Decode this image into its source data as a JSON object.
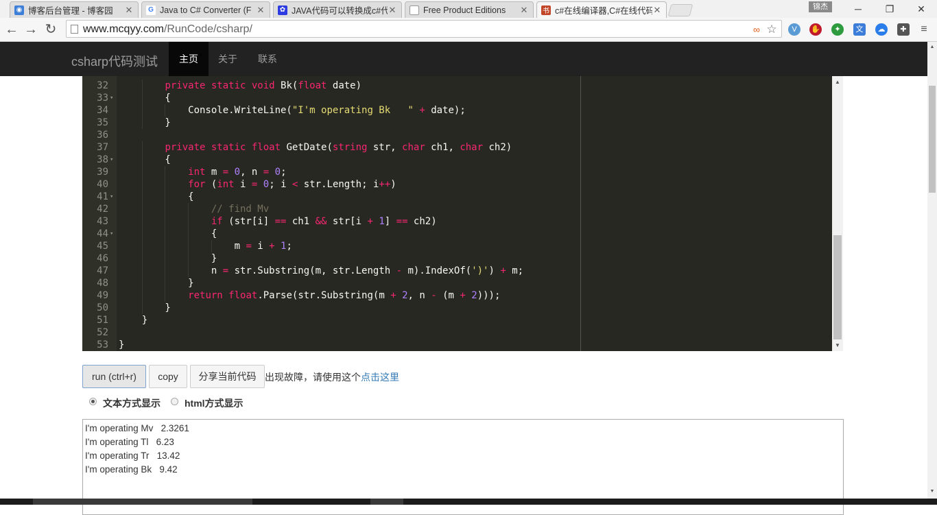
{
  "browser": {
    "tabs": [
      {
        "title": "博客后台管理 - 博客园",
        "icon_color": "#3d7fd8",
        "icon": "cnblogs-icon",
        "active": false
      },
      {
        "title": "Java to C# Converter (F",
        "icon_color": "#ffffff",
        "icon": "google-icon",
        "active": false
      },
      {
        "title": "JAVA代码可以转换成c#代",
        "icon_color": "#2d3ce0",
        "icon": "baidu-paw-icon",
        "active": false
      },
      {
        "title": "Free Product Editions",
        "icon_color": "#ffffff",
        "icon": "page-icon",
        "active": false
      },
      {
        "title": "c#在线编译器,C#在线代码",
        "icon_color": "#c2472a",
        "icon": "book-icon",
        "icon_glyph": "书",
        "active": true
      }
    ],
    "user_badge": "锦杰",
    "window_controls": [
      "minimize",
      "restore",
      "close"
    ],
    "url_host": "www.mcqyy.com",
    "url_path": "/RunCode/csharp/",
    "toolbar_icons": [
      "infinity-icon",
      "star-icon",
      "v-icon",
      "adblock-icon",
      "frog-icon",
      "translate-icon",
      "cloud-icon",
      "puzzle-icon",
      "menu-icon"
    ]
  },
  "site": {
    "brand": "csharp代码测试",
    "nav": [
      {
        "label": "主页",
        "active": true
      },
      {
        "label": "关于",
        "active": false
      },
      {
        "label": "联系",
        "active": false
      }
    ]
  },
  "editor": {
    "lines": [
      {
        "n": "32",
        "fold": false,
        "tokens": [
          [
            "",
            "        "
          ],
          [
            "kw",
            "private static void"
          ],
          [
            "",
            " Bk("
          ],
          [
            "kw",
            "float"
          ],
          [
            "",
            " date)"
          ]
        ]
      },
      {
        "n": "33",
        "fold": true,
        "tokens": [
          [
            "",
            "        {"
          ]
        ]
      },
      {
        "n": "34",
        "fold": false,
        "tokens": [
          [
            "",
            "            Console.WriteLine("
          ],
          [
            "str",
            "\"I'm operating Bk   \""
          ],
          [
            "",
            " "
          ],
          [
            "kw",
            "+"
          ],
          [
            "",
            " date);"
          ]
        ]
      },
      {
        "n": "35",
        "fold": false,
        "tokens": [
          [
            "",
            "        }"
          ]
        ]
      },
      {
        "n": "36",
        "fold": false,
        "tokens": [
          [
            "",
            ""
          ]
        ]
      },
      {
        "n": "37",
        "fold": false,
        "tokens": [
          [
            "",
            "        "
          ],
          [
            "kw",
            "private static float"
          ],
          [
            "",
            " GetDate("
          ],
          [
            "kw",
            "string"
          ],
          [
            "",
            " str, "
          ],
          [
            "kw",
            "char"
          ],
          [
            "",
            " ch1, "
          ],
          [
            "kw",
            "char"
          ],
          [
            "",
            " ch2)"
          ]
        ]
      },
      {
        "n": "38",
        "fold": true,
        "tokens": [
          [
            "",
            "        {"
          ]
        ]
      },
      {
        "n": "39",
        "fold": false,
        "tokens": [
          [
            "",
            "            "
          ],
          [
            "kw",
            "int"
          ],
          [
            "",
            " m "
          ],
          [
            "kw",
            "="
          ],
          [
            "",
            " "
          ],
          [
            "numc",
            "0"
          ],
          [
            "",
            ", n "
          ],
          [
            "kw",
            "="
          ],
          [
            "",
            " "
          ],
          [
            "numc",
            "0"
          ],
          [
            "",
            ";"
          ]
        ]
      },
      {
        "n": "40",
        "fold": false,
        "tokens": [
          [
            "",
            "            "
          ],
          [
            "kw",
            "for"
          ],
          [
            "",
            " ("
          ],
          [
            "kw",
            "int"
          ],
          [
            "",
            " i "
          ],
          [
            "kw",
            "="
          ],
          [
            "",
            " "
          ],
          [
            "numc",
            "0"
          ],
          [
            "",
            "; i "
          ],
          [
            "kw",
            "<"
          ],
          [
            "",
            " str.Length; i"
          ],
          [
            "kw",
            "++"
          ],
          [
            "",
            ")"
          ]
        ]
      },
      {
        "n": "41",
        "fold": true,
        "tokens": [
          [
            "",
            "            {"
          ]
        ]
      },
      {
        "n": "42",
        "fold": false,
        "tokens": [
          [
            "",
            "                "
          ],
          [
            "cmt",
            "// find Mv"
          ]
        ]
      },
      {
        "n": "43",
        "fold": false,
        "tokens": [
          [
            "",
            "                "
          ],
          [
            "kw",
            "if"
          ],
          [
            "",
            " (str[i] "
          ],
          [
            "kw",
            "=="
          ],
          [
            "",
            " ch1 "
          ],
          [
            "kw",
            "&&"
          ],
          [
            "",
            " str[i "
          ],
          [
            "kw",
            "+"
          ],
          [
            "",
            " "
          ],
          [
            "numc",
            "1"
          ],
          [
            "",
            "] "
          ],
          [
            "kw",
            "=="
          ],
          [
            "",
            " ch2)"
          ]
        ]
      },
      {
        "n": "44",
        "fold": true,
        "tokens": [
          [
            "",
            "                {"
          ]
        ]
      },
      {
        "n": "45",
        "fold": false,
        "tokens": [
          [
            "",
            "                    m "
          ],
          [
            "kw",
            "="
          ],
          [
            "",
            " i "
          ],
          [
            "kw",
            "+"
          ],
          [
            "",
            " "
          ],
          [
            "numc",
            "1"
          ],
          [
            "",
            ";"
          ]
        ]
      },
      {
        "n": "46",
        "fold": false,
        "tokens": [
          [
            "",
            "                }"
          ]
        ]
      },
      {
        "n": "47",
        "fold": false,
        "tokens": [
          [
            "",
            "                n "
          ],
          [
            "kw",
            "="
          ],
          [
            "",
            " str.Substring(m, str.Length "
          ],
          [
            "kw",
            "-"
          ],
          [
            "",
            " m).IndexOf("
          ],
          [
            "str",
            "')'"
          ],
          [
            "",
            ") "
          ],
          [
            "kw",
            "+"
          ],
          [
            "",
            " m;"
          ]
        ]
      },
      {
        "n": "48",
        "fold": false,
        "tokens": [
          [
            "",
            "            }"
          ]
        ]
      },
      {
        "n": "49",
        "fold": false,
        "tokens": [
          [
            "",
            "            "
          ],
          [
            "kw",
            "return"
          ],
          [
            "",
            " "
          ],
          [
            "kw",
            "float"
          ],
          [
            "",
            ".Parse(str.Substring(m "
          ],
          [
            "kw",
            "+"
          ],
          [
            "",
            " "
          ],
          [
            "numc",
            "2"
          ],
          [
            "",
            ", n "
          ],
          [
            "kw",
            "-"
          ],
          [
            "",
            " (m "
          ],
          [
            "kw",
            "+"
          ],
          [
            "",
            " "
          ],
          [
            "numc",
            "2"
          ],
          [
            "",
            ")));"
          ]
        ]
      },
      {
        "n": "50",
        "fold": false,
        "tokens": [
          [
            "",
            "        }"
          ]
        ]
      },
      {
        "n": "51",
        "fold": false,
        "tokens": [
          [
            "",
            "    }"
          ]
        ]
      },
      {
        "n": "52",
        "fold": false,
        "tokens": [
          [
            "",
            ""
          ]
        ]
      },
      {
        "n": "53",
        "fold": false,
        "tokens": [
          [
            "",
            "}"
          ]
        ]
      }
    ]
  },
  "controls": {
    "run_label": "run (ctrl+r)",
    "copy_label": "copy",
    "share_label": "分享当前代码",
    "notice_text": "出现故障，请使用这个",
    "notice_link": "点击这里",
    "radio_text_label": "文本方式显示",
    "radio_html_label": "html方式显示",
    "selected_mode": "text"
  },
  "output": {
    "lines": [
      "I'm operating Mv   2.3261",
      "I'm operating Tl   6.23",
      "I'm operating Tr   13.42",
      "I'm operating Bk   9.42"
    ]
  }
}
